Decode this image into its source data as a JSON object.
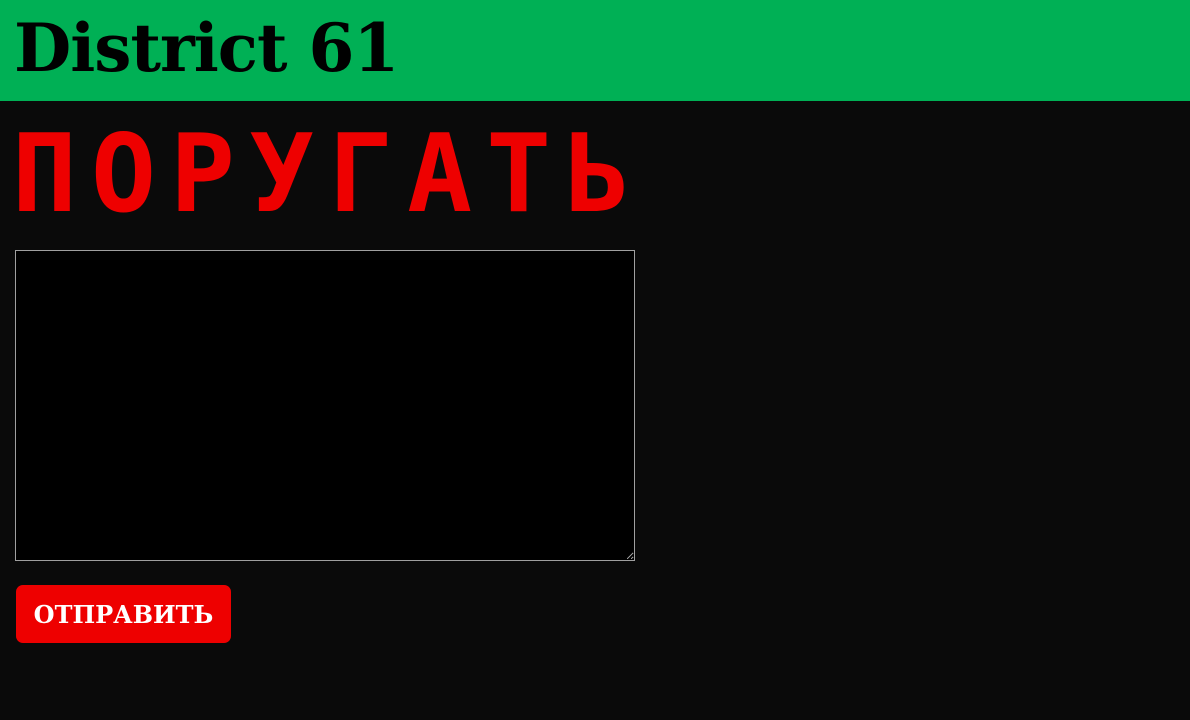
{
  "header": {
    "title": "District 61"
  },
  "main": {
    "heading": "ПОРУГАТЬ",
    "message_input": {
      "value": "",
      "placeholder": ""
    },
    "submit_label": "ОТПРАВИТЬ"
  },
  "colors": {
    "header_background": "#00b055",
    "page_background": "#0a0a0a",
    "accent_red": "#ee0000",
    "textarea_background": "#000000"
  }
}
